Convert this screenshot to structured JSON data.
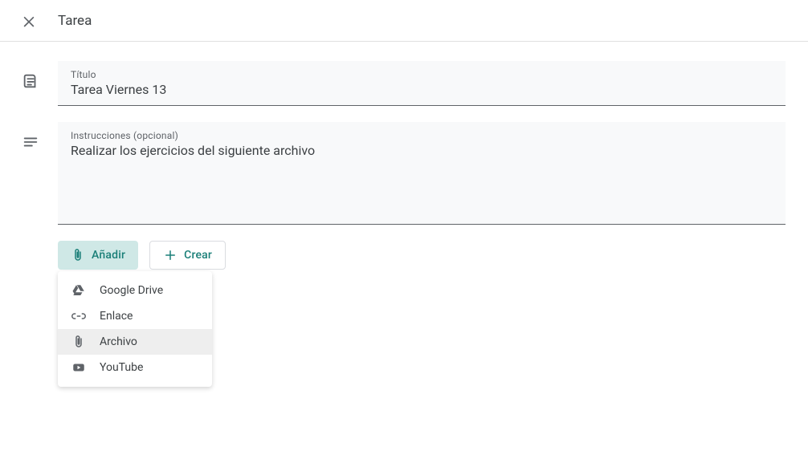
{
  "header": {
    "title": "Tarea"
  },
  "titleField": {
    "label": "Título",
    "value": "Tarea Viernes 13"
  },
  "instructionsField": {
    "label": "Instrucciones (opcional)",
    "value": "Realizar los ejercicios del siguiente archivo"
  },
  "buttons": {
    "add": "Añadir",
    "create": "Crear"
  },
  "addMenu": {
    "items": [
      {
        "label": "Google Drive"
      },
      {
        "label": "Enlace"
      },
      {
        "label": "Archivo"
      },
      {
        "label": "YouTube"
      }
    ]
  }
}
